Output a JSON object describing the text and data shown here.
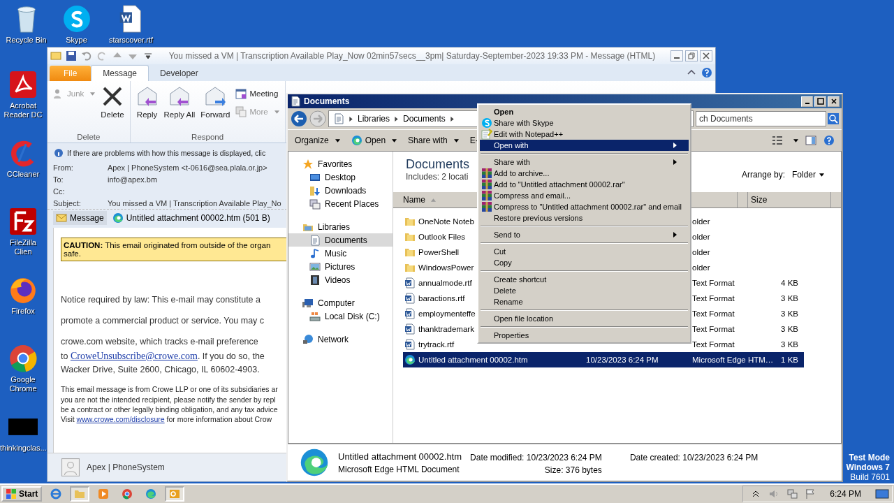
{
  "desktop_icons": [
    {
      "label": "Recycle Bin",
      "kind": "recycle"
    },
    {
      "label": "Skype",
      "kind": "skype"
    },
    {
      "label": "starscover.rtf",
      "kind": "word"
    },
    {
      "label": "Acrobat Reader DC",
      "kind": "acrobat"
    },
    {
      "label": "CCleaner",
      "kind": "ccleaner"
    },
    {
      "label": "FileZilla Clien",
      "kind": "filezilla"
    },
    {
      "label": "Firefox",
      "kind": "firefox"
    },
    {
      "label": "Google Chrome",
      "kind": "chrome"
    },
    {
      "label": "thinkingclas...",
      "kind": "blank"
    }
  ],
  "outlook": {
    "title": "You missed a VM | Transcription Available Play_Now 02min57secs__3pm| Saturday-September-2023 19:33 PM - Message (HTML)",
    "tabs": [
      {
        "label": "File",
        "kind": "file",
        "selected": false
      },
      {
        "label": "Message",
        "kind": "tab",
        "selected": true
      },
      {
        "label": "Developer",
        "kind": "tab",
        "selected": false
      }
    ],
    "groups": [
      {
        "name": "Delete",
        "buttons": [
          {
            "label": "Junk",
            "kind": "junk",
            "disabled": true
          },
          {
            "label": "Delete",
            "kind": "delete",
            "disabled": false
          }
        ]
      },
      {
        "name": "Respond",
        "buttons": [
          {
            "label": "Reply",
            "kind": "reply",
            "disabled": false
          },
          {
            "label": "Reply All",
            "kind": "replyall",
            "disabled": false
          },
          {
            "label": "Forward",
            "kind": "forward",
            "disabled": false
          },
          {
            "label": "Meeting",
            "kind": "meeting",
            "disabled": false
          },
          {
            "label": "More",
            "kind": "more",
            "disabled": true
          }
        ]
      }
    ],
    "info_bar": "If there are problems with how this message is displayed, clic",
    "headers": [
      {
        "label": "From:",
        "value": "Apex | PhoneSystem <t-0616@sea.plala.or.jp>"
      },
      {
        "label": "To:",
        "value": "info@apex.bm"
      },
      {
        "label": "Cc:"
      },
      {
        "label": "Subject:",
        "value": "You missed a VM | Transcription Available Play_No"
      }
    ],
    "attachments": [
      {
        "label": "Message",
        "kind": "message",
        "selected": true
      },
      {
        "label": "Untitled attachment 00002.htm (501 B)",
        "kind": "edge",
        "selected": false
      }
    ],
    "caution": [
      "**CAUTION:** This email originated from outside of the organ",
      "safe."
    ],
    "body": [
      {
        "kind": "para",
        "text": "Notice required by law: This e-mail may constitute a"
      },
      {
        "kind": "para",
        "text": "promote a commercial product or service. You may c"
      },
      {
        "kind": "para",
        "text": "crowe.com website, which tracks e-mail preference"
      },
      {
        "kind": "line",
        "text": "to ",
        "link": "CroweUnsubscribe@crowe.com",
        "after": ". If you do so, the"
      },
      {
        "kind": "line",
        "text": "Wacker Drive, Suite 2600, Chicago, IL 60602-4903."
      },
      {
        "kind": "small_first",
        "text": "This email message is from Crowe LLP or one of its subsidiaries ar"
      },
      {
        "kind": "small",
        "text": "you are not the intended recipient, please notify the sender by repl"
      },
      {
        "kind": "small",
        "text": "be a contract or other legally binding obligation, and any tax advice"
      },
      {
        "kind": "small",
        "text": "Visit ",
        "link": "www.crowe.com/disclosure",
        "after": " for more information about Crow"
      }
    ],
    "sender": "Apex | PhoneSystem"
  },
  "explorer": {
    "title": "Documents",
    "breadcrumb": [
      "Libraries",
      "Documents"
    ],
    "search_placeholder": "ch Documents",
    "toolbar": [
      {
        "label": "Organize",
        "kind": "menu"
      },
      {
        "label": "Open",
        "kind": "edge"
      },
      {
        "label": "Share with",
        "kind": "menu"
      },
      {
        "label": "E-",
        "kind": "plain"
      }
    ],
    "nav": [
      {
        "label": "Favorites",
        "kind": "star",
        "selected": false,
        "children": [
          {
            "label": "Desktop",
            "kind": "desktop",
            "selected": false
          },
          {
            "label": "Downloads",
            "kind": "downloads",
            "selected": false
          },
          {
            "label": "Recent Places",
            "kind": "recent",
            "selected": false
          }
        ]
      },
      {
        "label": "Libraries",
        "kind": "library",
        "selected": false,
        "children": [
          {
            "label": "Documents",
            "kind": "doc",
            "selected": true
          },
          {
            "label": "Music",
            "kind": "music",
            "selected": false
          },
          {
            "label": "Pictures",
            "kind": "pictures",
            "selected": false
          },
          {
            "label": "Videos",
            "kind": "videos",
            "selected": false
          }
        ]
      },
      {
        "label": "Computer",
        "kind": "computer",
        "selected": false,
        "children": [
          {
            "label": "Local Disk (C:)",
            "kind": "disk",
            "selected": false
          }
        ]
      },
      {
        "label": "Network",
        "kind": "network",
        "selected": false
      }
    ],
    "library_title": "Documents",
    "includes": "Includes:  2 locati",
    "arrange_label": "Arrange by:",
    "arrange_value": "Folder",
    "columns": [
      "Name",
      "Size"
    ],
    "files": [
      {
        "name": "OneNote Noteb",
        "type": "older",
        "kind": "folder",
        "selected": false
      },
      {
        "name": "Outlook Files",
        "type": "older",
        "kind": "folder",
        "selected": false
      },
      {
        "name": "PowerShell",
        "type": "older",
        "kind": "folder",
        "selected": false
      },
      {
        "name": "WindowsPower",
        "type": "older",
        "kind": "folder",
        "selected": false
      },
      {
        "name": "annualmode.rtf",
        "type": "Text Format",
        "size": "4 KB",
        "kind": "word",
        "selected": false
      },
      {
        "name": "baractions.rtf",
        "type": "Text Format",
        "size": "3 KB",
        "kind": "word",
        "selected": false
      },
      {
        "name": "employmenteffe",
        "type": "Text Format",
        "size": "3 KB",
        "kind": "word",
        "selected": false
      },
      {
        "name": "thanktrademark",
        "type": "Text Format",
        "size": "3 KB",
        "kind": "word",
        "selected": false
      },
      {
        "name": "trytrack.rtf",
        "type": "Text Format",
        "size": "3 KB",
        "kind": "word",
        "selected": false
      },
      {
        "name": "Untitled attachment 00002.htm",
        "date": "10/23/2023 6:24 PM",
        "type": "Microsoft Edge HTM…",
        "size": "1 KB",
        "kind": "edge",
        "selected": true
      }
    ],
    "details": {
      "name": "Untitled attachment 00002.htm",
      "type": "Microsoft Edge HTML Document",
      "fields": [
        {
          "label": "Date modified:",
          "value": "10/23/2023 6:24 PM"
        },
        {
          "label": "Size:",
          "value": "376 bytes"
        },
        {
          "label": "Date created:",
          "value": "10/23/2023 6:24 PM"
        }
      ]
    }
  },
  "context_menu": [
    [
      {
        "label": "Open",
        "kind": "none",
        "default": true,
        "submenu": false,
        "selected": false
      },
      {
        "label": "Share with Skype",
        "kind": "skype",
        "default": false,
        "submenu": false,
        "selected": false
      },
      {
        "label": "Edit with Notepad++",
        "kind": "notepad",
        "default": false,
        "submenu": false,
        "selected": false
      },
      {
        "label": "Open with",
        "kind": "none",
        "default": false,
        "submenu": true,
        "selected": true
      }
    ],
    [
      {
        "label": "Share with",
        "kind": "none",
        "default": false,
        "submenu": true,
        "selected": false
      },
      {
        "label": "Add to archive...",
        "kind": "rar",
        "default": false,
        "submenu": false,
        "selected": false
      },
      {
        "label": "Add to \"Untitled attachment 00002.rar\"",
        "kind": "rar",
        "default": false,
        "submenu": false,
        "selected": false
      },
      {
        "label": "Compress and email...",
        "kind": "rar",
        "default": false,
        "submenu": false,
        "selected": false
      },
      {
        "label": "Compress to \"Untitled attachment 00002.rar\" and email",
        "kind": "rar",
        "default": false,
        "submenu": false,
        "selected": false
      },
      {
        "label": "Restore previous versions",
        "kind": "none",
        "default": false,
        "submenu": false,
        "selected": false
      }
    ],
    [
      {
        "label": "Send to",
        "kind": "none",
        "default": false,
        "submenu": true,
        "selected": false
      }
    ],
    [
      {
        "label": "Cut",
        "kind": "none",
        "default": false,
        "submenu": false,
        "selected": false
      },
      {
        "label": "Copy",
        "kind": "none",
        "default": false,
        "submenu": false,
        "selected": false
      }
    ],
    [
      {
        "label": "Create shortcut",
        "kind": "none",
        "default": false,
        "submenu": false,
        "selected": false
      },
      {
        "label": "Delete",
        "kind": "none",
        "default": false,
        "submenu": false,
        "selected": false
      },
      {
        "label": "Rename",
        "kind": "none",
        "default": false,
        "submenu": false,
        "selected": false
      }
    ],
    [
      {
        "label": "Open file location",
        "kind": "none",
        "default": false,
        "submenu": false,
        "selected": false
      }
    ],
    [
      {
        "label": "Properties",
        "kind": "none",
        "default": false,
        "submenu": false,
        "selected": false
      }
    ]
  ],
  "test_mode": [
    "Test Mode",
    "Windows 7",
    "Build 7601"
  ],
  "taskbar": {
    "start": "Start",
    "apps": [
      {
        "kind": "ie",
        "selected": false
      },
      {
        "kind": "folder",
        "selected": true
      },
      {
        "kind": "media",
        "selected": false
      },
      {
        "kind": "chrome",
        "selected": false
      },
      {
        "kind": "edge",
        "selected": false
      },
      {
        "kind": "outlook",
        "selected": true
      }
    ],
    "clock": "6:24 PM"
  }
}
